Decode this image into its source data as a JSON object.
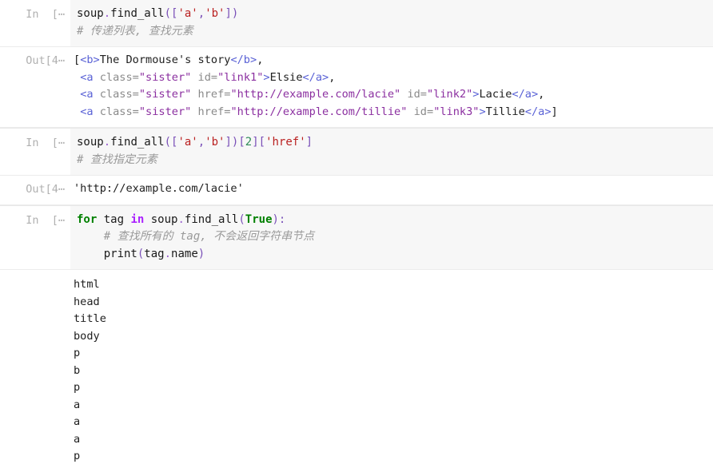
{
  "app": {
    "name": "jupyter-notebook",
    "background": "#ffffff",
    "code_cell_background": "#f7f7f7"
  },
  "colors": {
    "keyword": "#008000",
    "keyword_operator": "#aa22ff",
    "string": "#ba2121",
    "number": "#2e8b57",
    "punctuation": "#7a50b8",
    "comment": "#9a9a9a",
    "prompt": "#b0b0b0",
    "tag": "#5a62d6",
    "attr_value": "#8b2fa0"
  },
  "cells": [
    {
      "type": "input",
      "prompt": "In  [⋯",
      "lines": [
        {
          "tokens": [
            {
              "t": "soup",
              "c": "tok-plain"
            },
            {
              "t": ".",
              "c": "tok-op"
            },
            {
              "t": "find_all",
              "c": "tok-plain"
            },
            {
              "t": "([",
              "c": "tok-punct"
            },
            {
              "t": "'a'",
              "c": "tok-str"
            },
            {
              "t": ",",
              "c": "tok-punct"
            },
            {
              "t": "'b'",
              "c": "tok-str"
            },
            {
              "t": "])",
              "c": "tok-punct"
            }
          ]
        },
        {
          "tokens": [
            {
              "t": "# 传递列表, 查找元素",
              "c": "tok-comment"
            }
          ]
        }
      ]
    },
    {
      "type": "output",
      "prompt": "Out[4⋯",
      "lines": [
        {
          "tokens": [
            {
              "t": "[",
              "c": "r-plain"
            },
            {
              "t": "<b>",
              "c": "r-tag"
            },
            {
              "t": "The Dormouse's story",
              "c": "r-plain"
            },
            {
              "t": "</b>",
              "c": "r-tag"
            },
            {
              "t": ",",
              "c": "r-plain"
            }
          ]
        },
        {
          "tokens": [
            {
              "t": " ",
              "c": "r-plain"
            },
            {
              "t": "<a ",
              "c": "r-tag"
            },
            {
              "t": "class=",
              "c": "r-attr"
            },
            {
              "t": "\"sister\"",
              "c": "r-val"
            },
            {
              "t": " ",
              "c": "r-plain"
            },
            {
              "t": "id=",
              "c": "r-attr"
            },
            {
              "t": "\"link1\"",
              "c": "r-val"
            },
            {
              "t": ">",
              "c": "r-tag"
            },
            {
              "t": "Elsie",
              "c": "r-plain"
            },
            {
              "t": "</a>",
              "c": "r-tag"
            },
            {
              "t": ",",
              "c": "r-plain"
            }
          ]
        },
        {
          "tokens": [
            {
              "t": " ",
              "c": "r-plain"
            },
            {
              "t": "<a ",
              "c": "r-tag"
            },
            {
              "t": "class=",
              "c": "r-attr"
            },
            {
              "t": "\"sister\"",
              "c": "r-val"
            },
            {
              "t": " ",
              "c": "r-plain"
            },
            {
              "t": "href=",
              "c": "r-attr"
            },
            {
              "t": "\"http://example.com/lacie\"",
              "c": "r-val"
            },
            {
              "t": " ",
              "c": "r-plain"
            },
            {
              "t": "id=",
              "c": "r-attr"
            },
            {
              "t": "\"link2\"",
              "c": "r-val"
            },
            {
              "t": ">",
              "c": "r-tag"
            },
            {
              "t": "Lacie",
              "c": "r-plain"
            },
            {
              "t": "</a>",
              "c": "r-tag"
            },
            {
              "t": ",",
              "c": "r-plain"
            }
          ]
        },
        {
          "tokens": [
            {
              "t": " ",
              "c": "r-plain"
            },
            {
              "t": "<a ",
              "c": "r-tag"
            },
            {
              "t": "class=",
              "c": "r-attr"
            },
            {
              "t": "\"sister\"",
              "c": "r-val"
            },
            {
              "t": " ",
              "c": "r-plain"
            },
            {
              "t": "href=",
              "c": "r-attr"
            },
            {
              "t": "\"http://example.com/tillie\"",
              "c": "r-val"
            },
            {
              "t": " ",
              "c": "r-plain"
            },
            {
              "t": "id=",
              "c": "r-attr"
            },
            {
              "t": "\"link3\"",
              "c": "r-val"
            },
            {
              "t": ">",
              "c": "r-tag"
            },
            {
              "t": "Tillie",
              "c": "r-plain"
            },
            {
              "t": "</a>",
              "c": "r-tag"
            },
            {
              "t": "]",
              "c": "r-plain"
            }
          ]
        }
      ]
    },
    {
      "type": "input",
      "prompt": "In  [⋯",
      "lines": [
        {
          "tokens": [
            {
              "t": "soup",
              "c": "tok-plain"
            },
            {
              "t": ".",
              "c": "tok-op"
            },
            {
              "t": "find_all",
              "c": "tok-plain"
            },
            {
              "t": "([",
              "c": "tok-punct"
            },
            {
              "t": "'a'",
              "c": "tok-str"
            },
            {
              "t": ",",
              "c": "tok-punct"
            },
            {
              "t": "'b'",
              "c": "tok-str"
            },
            {
              "t": "])[",
              "c": "tok-punct"
            },
            {
              "t": "2",
              "c": "tok-num"
            },
            {
              "t": "][",
              "c": "tok-punct"
            },
            {
              "t": "'href'",
              "c": "tok-str"
            },
            {
              "t": "]",
              "c": "tok-punct"
            }
          ]
        },
        {
          "tokens": [
            {
              "t": "# 查找指定元素",
              "c": "tok-comment"
            }
          ]
        }
      ]
    },
    {
      "type": "output",
      "prompt": "Out[4⋯",
      "lines": [
        {
          "tokens": [
            {
              "t": "'http://example.com/lacie'",
              "c": "r-str"
            }
          ]
        }
      ]
    },
    {
      "type": "input",
      "prompt": "In  [⋯",
      "lines": [
        {
          "tokens": [
            {
              "t": "for",
              "c": "tok-kw"
            },
            {
              "t": " tag ",
              "c": "tok-plain"
            },
            {
              "t": "in",
              "c": "tok-kw2"
            },
            {
              "t": " soup",
              "c": "tok-plain"
            },
            {
              "t": ".",
              "c": "tok-op"
            },
            {
              "t": "find_all",
              "c": "tok-plain"
            },
            {
              "t": "(",
              "c": "tok-punct"
            },
            {
              "t": "True",
              "c": "tok-const"
            },
            {
              "t": "):",
              "c": "tok-punct"
            }
          ]
        },
        {
          "tokens": [
            {
              "t": "    ",
              "c": "tok-plain"
            },
            {
              "t": "# 查找所有的 tag, 不会返回字符串节点",
              "c": "tok-comment"
            }
          ]
        },
        {
          "tokens": [
            {
              "t": "    print",
              "c": "tok-plain"
            },
            {
              "t": "(",
              "c": "tok-punct"
            },
            {
              "t": "tag",
              "c": "tok-plain"
            },
            {
              "t": ".",
              "c": "tok-op"
            },
            {
              "t": "name",
              "c": "tok-plain"
            },
            {
              "t": ")",
              "c": "tok-punct"
            }
          ]
        }
      ]
    },
    {
      "type": "stdout",
      "prompt": "",
      "lines": [
        {
          "tokens": [
            {
              "t": "html",
              "c": "r-plain"
            }
          ]
        },
        {
          "tokens": [
            {
              "t": "head",
              "c": "r-plain"
            }
          ]
        },
        {
          "tokens": [
            {
              "t": "title",
              "c": "r-plain"
            }
          ]
        },
        {
          "tokens": [
            {
              "t": "body",
              "c": "r-plain"
            }
          ]
        },
        {
          "tokens": [
            {
              "t": "p",
              "c": "r-plain"
            }
          ]
        },
        {
          "tokens": [
            {
              "t": "b",
              "c": "r-plain"
            }
          ]
        },
        {
          "tokens": [
            {
              "t": "p",
              "c": "r-plain"
            }
          ]
        },
        {
          "tokens": [
            {
              "t": "a",
              "c": "r-plain"
            }
          ]
        },
        {
          "tokens": [
            {
              "t": "a",
              "c": "r-plain"
            }
          ]
        },
        {
          "tokens": [
            {
              "t": "a",
              "c": "r-plain"
            }
          ]
        },
        {
          "tokens": [
            {
              "t": "p",
              "c": "r-plain"
            }
          ]
        }
      ]
    }
  ]
}
